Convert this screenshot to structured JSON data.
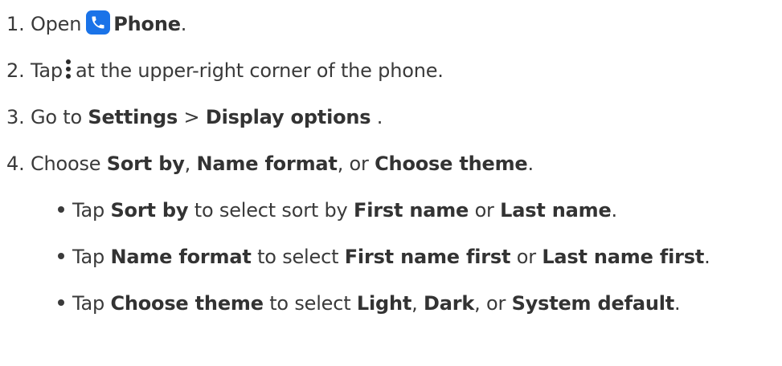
{
  "steps": {
    "s1": {
      "num": "1. ",
      "pre": "Open",
      "icon": "phone-app-icon",
      "app": "Phone",
      "post": "."
    },
    "s2": {
      "num": "2. ",
      "pre": "Tap",
      "icon": "more-vert-icon",
      "post": "at the upper-right corner of the phone."
    },
    "s3": {
      "num": "3. ",
      "pre": "Go to ",
      "settings": "Settings",
      "sep": " > ",
      "display": "Display options",
      "post": " ."
    },
    "s4": {
      "num": "4. ",
      "pre": "Choose ",
      "opt1": "Sort by",
      "c1": ", ",
      "opt2": "Name format",
      "c2": ", or ",
      "opt3": "Choose theme",
      "post": "."
    }
  },
  "bullets": {
    "b1": {
      "pre": "Tap ",
      "item": "Sort by",
      "mid": " to select sort by ",
      "a": "First name",
      "or": " or ",
      "b": "Last name",
      "post": "."
    },
    "b2": {
      "pre": "Tap ",
      "item": "Name format",
      "mid": " to select ",
      "a": "First name first",
      "or": " or ",
      "b": "Last name first",
      "post": "."
    },
    "b3": {
      "pre": "Tap ",
      "item": "Choose theme",
      "mid": " to select ",
      "a": "Light",
      "c1": ", ",
      "b": "Dark",
      "or": ", or ",
      "c": "System default",
      "post": "."
    }
  },
  "colors": {
    "text": "#3a3a3a",
    "phone_icon_bg": "#1a73e8"
  }
}
